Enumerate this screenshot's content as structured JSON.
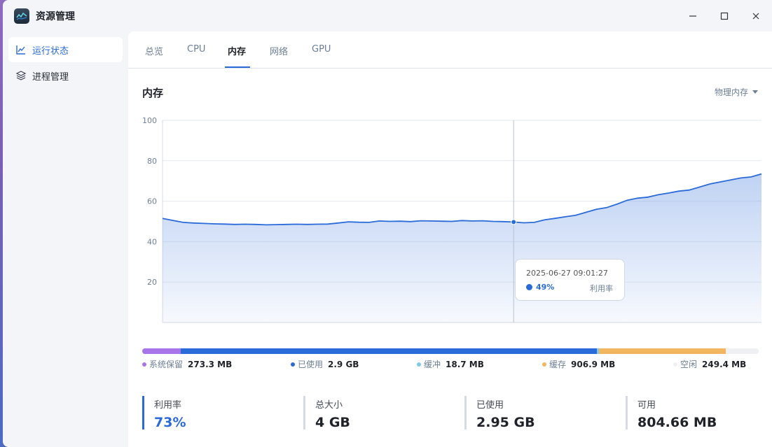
{
  "app": {
    "title": "资源管理"
  },
  "window_controls": {
    "minimize": "─",
    "maximize": "☐",
    "close": "✕"
  },
  "sidebar": {
    "items": [
      {
        "label": "运行状态",
        "icon": "chart-line-icon",
        "active": true
      },
      {
        "label": "进程管理",
        "icon": "layers-icon",
        "active": false
      }
    ]
  },
  "tabs": [
    {
      "label": "总览",
      "active": false
    },
    {
      "label": "CPU",
      "active": false
    },
    {
      "label": "内存",
      "active": true
    },
    {
      "label": "网络",
      "active": false
    },
    {
      "label": "GPU",
      "active": false
    }
  ],
  "section": {
    "title": "内存",
    "dropdown": "物理内存"
  },
  "chart_data": {
    "type": "area",
    "title": "",
    "xlabel": "",
    "ylabel": "",
    "ylim": [
      0,
      100
    ],
    "yticks": [
      "100",
      "80",
      "60",
      "40",
      "20"
    ],
    "grid": true,
    "series": [
      {
        "values": [
          51.5,
          50.5,
          49.5,
          49.2,
          49.0,
          48.8,
          48.7,
          48.5,
          48.6,
          48.5,
          48.3,
          48.4,
          48.5,
          48.6,
          48.5,
          48.6,
          48.7,
          49.2,
          49.8,
          49.6,
          49.5,
          50.2,
          50.0,
          50.1,
          49.9,
          50.3,
          50.2,
          50.1,
          50.0,
          50.4,
          50.2,
          50.3,
          50.0,
          49.9,
          49.7,
          49.3,
          49.5,
          50.8,
          51.5,
          52.3,
          53.0,
          54.5,
          56.0,
          56.8,
          58.5,
          60.5,
          61.5,
          62.0,
          63.2,
          64.0,
          65.0,
          65.5,
          67.0,
          68.5,
          69.5,
          70.5,
          71.5,
          72.0,
          73.5
        ]
      }
    ],
    "highlight_index": 34
  },
  "tooltip": {
    "time": "2025-06-27 09:01:27",
    "value": "49%",
    "label": "利用率"
  },
  "colors": {
    "system": "#a774e9",
    "used": "#2a6ad9",
    "buffer": "#7fc8e8",
    "cache": "#f2b660",
    "free": "#eef0f3"
  },
  "usage_bar": {
    "segments": [
      {
        "name": "system",
        "fraction": 0.062
      },
      {
        "name": "used",
        "fraction": 0.675
      },
      {
        "name": "buffer",
        "fraction": 0.004
      },
      {
        "name": "cache",
        "fraction": 0.206
      },
      {
        "name": "free",
        "fraction": 0.053
      }
    ]
  },
  "legend": [
    {
      "label": "系统保留",
      "value": "273.3 MB",
      "color": "#a774e9"
    },
    {
      "label": "已使用",
      "value": "2.9 GB",
      "color": "#2a6ad9"
    },
    {
      "label": "缓冲",
      "value": "18.7 MB",
      "color": "#7fc8e8"
    },
    {
      "label": "缓存",
      "value": "906.9 MB",
      "color": "#f2b660"
    },
    {
      "label": "空闲",
      "value": "249.4 MB",
      "color": "#eef0f3"
    }
  ],
  "stats": [
    {
      "label": "利用率",
      "value": "73%"
    },
    {
      "label": "总大小",
      "value": "4 GB"
    },
    {
      "label": "已使用",
      "value": "2.95 GB"
    },
    {
      "label": "可用",
      "value": "804.66 MB"
    }
  ]
}
